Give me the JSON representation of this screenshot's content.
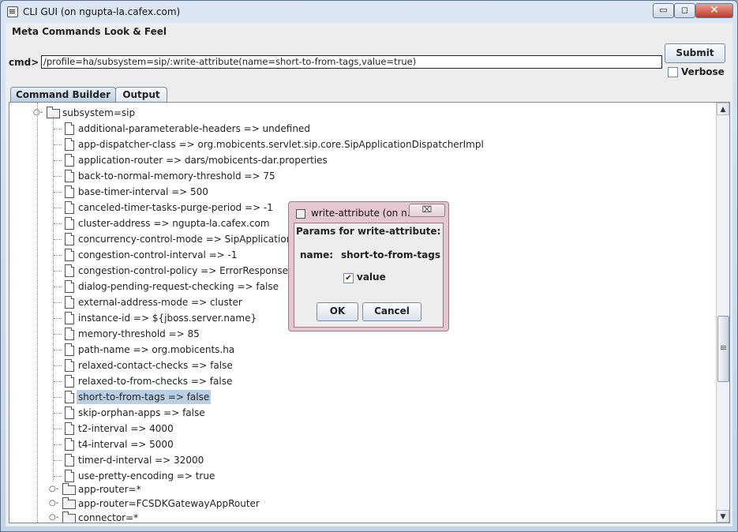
{
  "window": {
    "title": "CLI GUI (on ngupta-la.cafex.com)",
    "min_label": "▭",
    "max_label": "◻",
    "close_label": "✕"
  },
  "menubar": {
    "items": [
      "Meta Commands",
      "Look & Feel"
    ]
  },
  "cmd": {
    "label": "cmd>",
    "value": "/profile=ha/subsystem=sip/:write-attribute(name=short-to-from-tags,value=true)",
    "submit_label": "Submit",
    "verbose_label": "Verbose",
    "verbose_checked": false
  },
  "tabs": [
    {
      "label": "Command Builder",
      "active": true
    },
    {
      "label": "Output",
      "active": false
    }
  ],
  "tree": {
    "parent": "subsystem=sip",
    "attributes": [
      "additional-parameterable-headers => undefined",
      "app-dispatcher-class => org.mobicents.servlet.sip.core.SipApplicationDispatcherImpl",
      "application-router => dars/mobicents-dar.properties",
      "back-to-normal-memory-threshold => 75",
      "base-timer-interval => 500",
      "canceled-timer-tasks-purge-period => -1",
      "cluster-address => ngupta-la.cafex.com",
      "concurrency-control-mode => SipApplicationSe",
      "congestion-control-interval => -1",
      "congestion-control-policy => ErrorResponse",
      "dialog-pending-request-checking => false",
      "external-address-mode => cluster",
      "instance-id => ${jboss.server.name}",
      "memory-threshold => 85",
      "path-name => org.mobicents.ha",
      "relaxed-contact-checks => false",
      "relaxed-to-from-checks => false",
      "short-to-from-tags => false",
      "skip-orphan-apps => false",
      "t2-interval => 4000",
      "t4-interval => 5000",
      "timer-d-interval => 32000",
      "use-pretty-encoding => true"
    ],
    "selected_index": 17,
    "folders": [
      "app-router=*",
      "app-router=FCSDKGatewayAppRouter",
      "connector=*"
    ]
  },
  "dialog": {
    "title": "write-attribute (on n...",
    "close_label": "⌧",
    "heading": "Params for write-attribute:",
    "name_label": "name:",
    "name_value": "short-to-from-tags",
    "check_mark": "✔",
    "value_label": "value",
    "value_checked": true,
    "ok_label": "OK",
    "cancel_label": "Cancel"
  },
  "icons": {
    "scroll_up": "▲",
    "scroll_down": "▼",
    "expanded": "○-",
    "collapsed": "○-"
  }
}
